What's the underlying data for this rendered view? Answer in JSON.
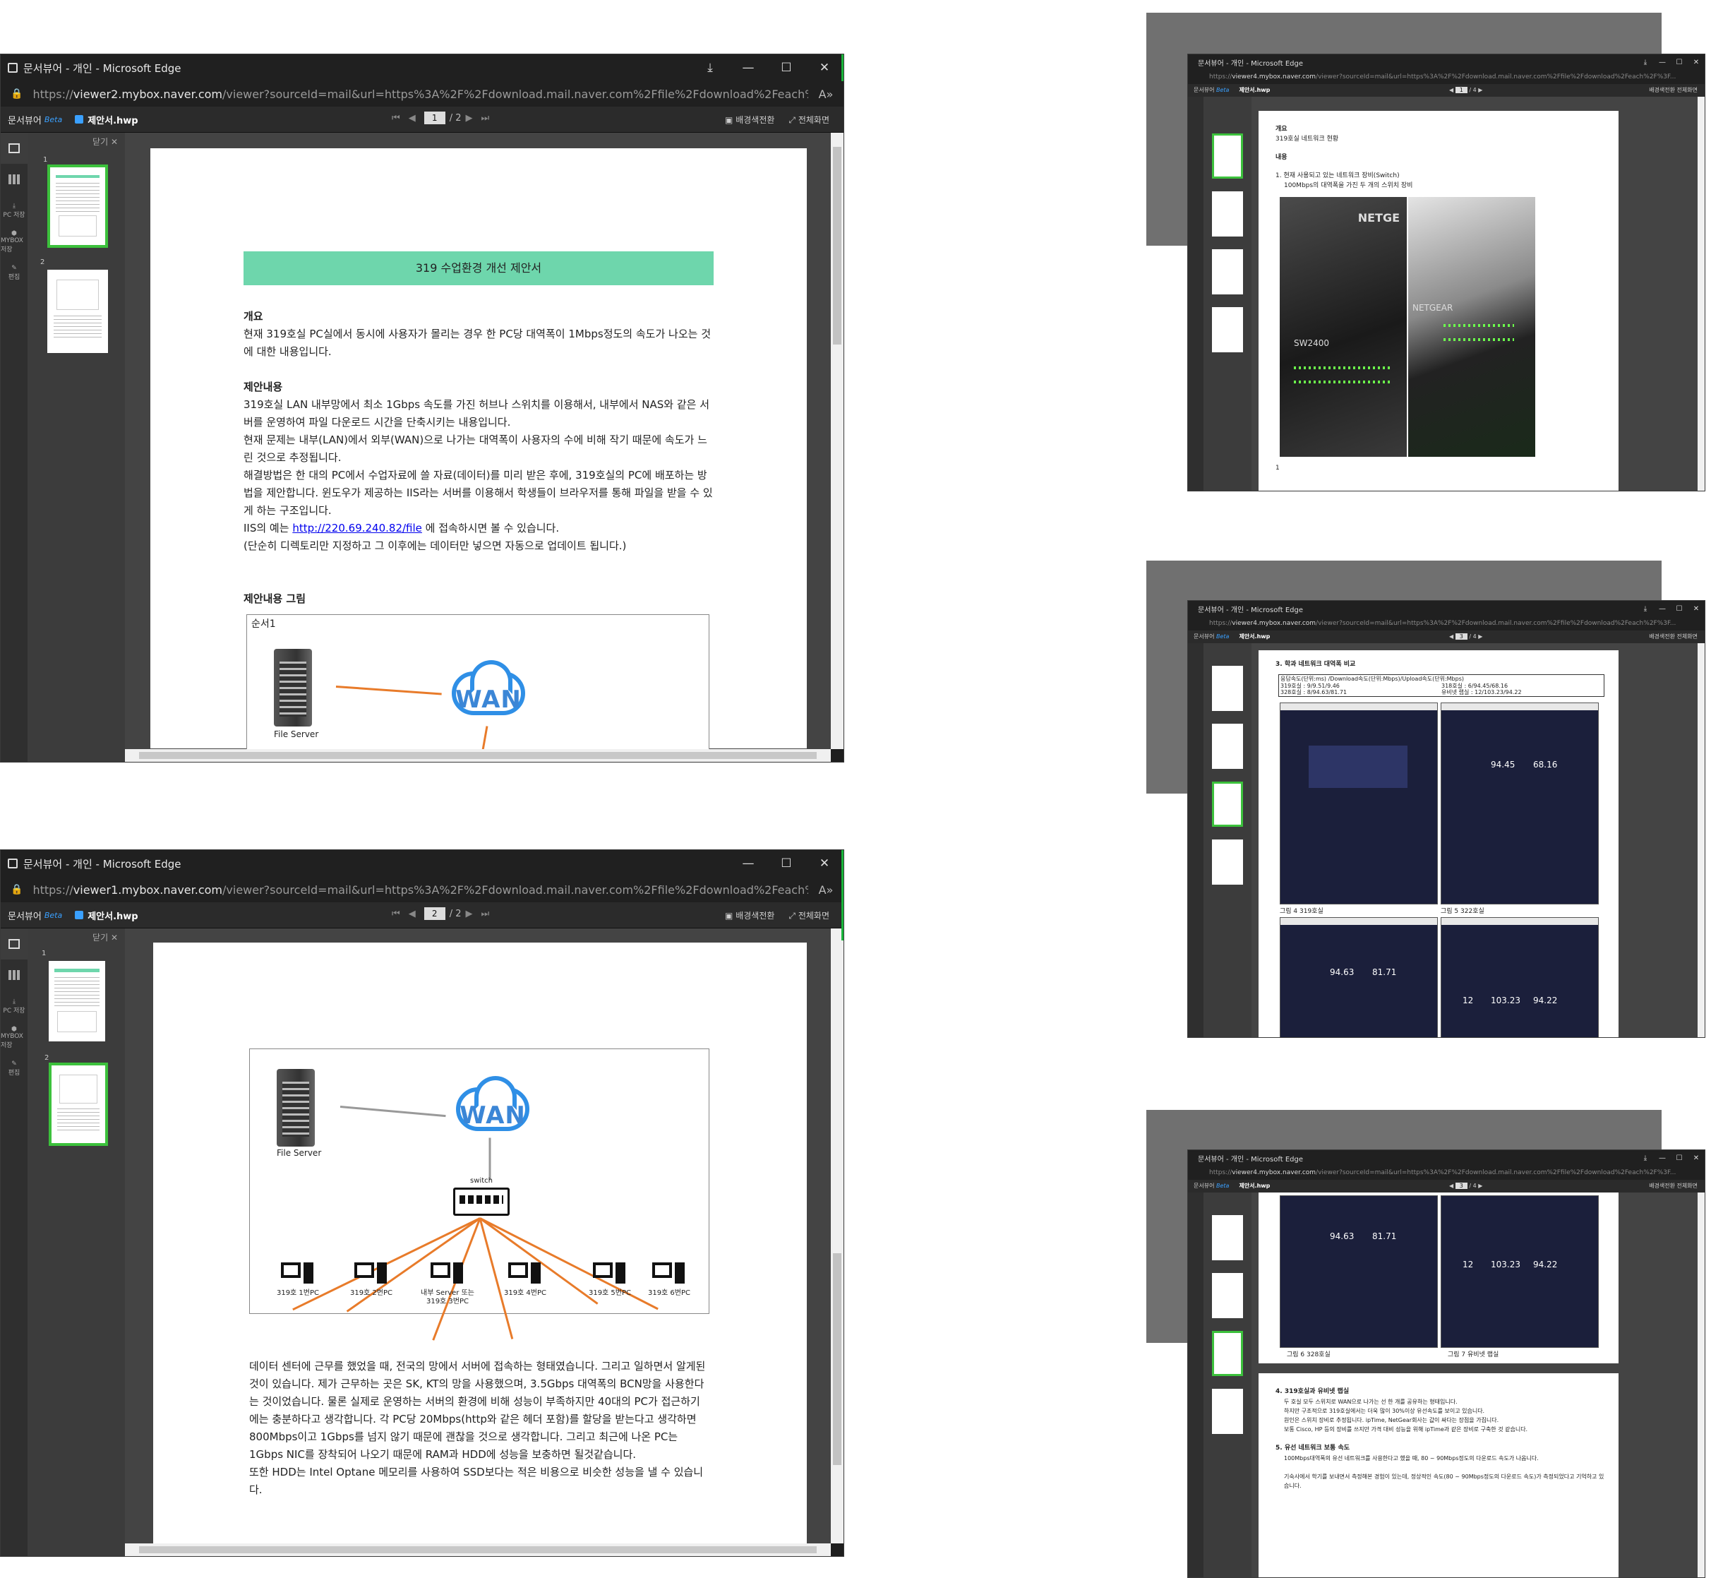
{
  "window_title": "문서뷰어 - 개인 - Microsoft Edge",
  "url_tl": {
    "pre": "https://",
    "host": "viewer2.mybox.naver.com",
    "rest": "/viewer?sourceId=mail&url=https%3A%2F%2Fdownload.mail.naver.com%2Ffile%2Fdownload%2Feach%2F%3Fattach..."
  },
  "url_bl": {
    "pre": "https://",
    "host": "viewer1.mybox.naver.com",
    "rest": "/viewer?sourceId=mail&url=https%3A%2F%2Fdownload.mail.naver.com%2Ffile%2Fdownload%2Feach%2F%3Fattach..."
  },
  "url_r": {
    "pre": "https://",
    "host": "viewer4.mybox.naver.com",
    "rest": "/viewer?sourceId=mail&url=https%3A%2F%2Fdownload.mail.naver.com%2Ffile%2Fdownload%2Feach%2F%3F..."
  },
  "toolbar": {
    "brand": "문서뷰어",
    "beta": "Beta",
    "filename": "제안서.hwp",
    "page_tl": "1",
    "page_bl": "2",
    "total_2": "/ 2",
    "total_4": "/ 4",
    "bg_toggle": "배경색전환",
    "fullscreen": "전체화면",
    "page_r1": "1",
    "page_r2": "3",
    "page_r3": "3"
  },
  "sidebar": {
    "pc_save": "PC 저장",
    "mybox_save": "MYBOX 저장",
    "edit": "편집"
  },
  "thumbpane": {
    "close": "닫기",
    "p1": "1",
    "p2": "2",
    "p3": "3",
    "p4": "4"
  },
  "page1": {
    "title": "319 수업환경 개선 제안서",
    "overview_h": "개요",
    "overview": "현재 319호실 PC실에서 동시에 사용자가 몰리는 경우 한 PC당 대역폭이 1Mbps정도의 속도가 나오는 것에 대한 내용입니다.",
    "proposal_h": "제안내용",
    "p1": "319호실 LAN 내부망에서 최소 1Gbps 속도를 가진 허브나 스위치를 이용해서, 내부에서 NAS와 같은 서버를 운영하여 파일 다운로드 시간을 단축시키는 내용입니다.",
    "p2": "현재 문제는 내부(LAN)에서 외부(WAN)으로 나가는 대역폭이 사용자의 수에 비해 작기 때문에 속도가 느린 것으로 추정됩니다.",
    "p3": "해결방법은 한 대의 PC에서 수업자료에 쓸 자료(데이터)를 미리 받은 후에, 319호실의 PC에 배포하는 방법을 제안합니다. 윈도우가 제공하는 IIS라는 서버를 이용해서 학생들이 브라우저를 통해 파일을 받을 수 있게 하는 구조입니다.",
    "p4_pre": "IIS의 예는 ",
    "p4_link": "http://220.69.240.82/file",
    "p4_post": " 에 접속하시면 볼 수 있습니다.",
    "p5": "(단순히 디렉토리만 지정하고 그 이후에는 데이터만 넣으면 자동으로 업데이트 됩니다.)",
    "figure_h": "제안내용 그림",
    "figure_step": "순서1",
    "file_server": "File Server",
    "wan": "WAN"
  },
  "page2": {
    "file_server": "File Server",
    "wan": "WAN",
    "switch": "switch",
    "pcs": [
      "319호 1번PC",
      "319호 2번PC",
      "내부 Server 또는 319호 3번PC",
      "319호 4번PC",
      "319호 5번PC",
      "319호 6번PC"
    ],
    "body1": "데이터 센터에 근무를 했었을 때, 전국의 망에서 서버에 접속하는 형태였습니다. 그리고 일하면서 알게된 것이 있습니다. 제가 근무하는 곳은 SK, KT의 망을 사용했으며, 3.5Gbps 대역폭의 BCN망을 사용한다는 것이었습니다. 물론 실제로 운영하는 서버의 환경에 비해 성능이 부족하지만 40대의 PC가 접근하기에는 충분하다고 생각합니다. 각 PC당 20Mbps(http와 같은 헤더 포함)를 할당을 받는다고 생각하면 800Mbps이고 1Gbps를 넘지 않기 때문에 괜찮을 것으로 생각합니다. 그리고 최근에 나온 PC는 1Gbps NIC를 장착되어 나오기 때문에 RAM과 HDD에 성능을 보충하면 될것같습니다.",
    "body2": "또한 HDD는 Intel Optane 메모리를 사용하여 SSD보다는 적은 비용으로 비슷한 성능을 낼 수 있습니다."
  },
  "r1": {
    "h1": "개요",
    "l1": "319호실 네트워크 현황",
    "h2": "내용",
    "l2": "1. 현재 사용되고 있는 네트워크 장비(Switch)",
    "l3": "100Mbps의 대역폭을 가진 두 개의 스위치 장비",
    "brand1": "NETGE",
    "brand2": "NETGEAR",
    "model": "SW2400",
    "pnum": "1"
  },
  "r2": {
    "h": "3. 학과 네트워크 대역폭 비교",
    "thead": "응답속도(단위:ms) /Download속도(단위:Mbps)/Upload속도(단위:Mbps)",
    "c1": "319호실 : 9/9.51/9.46",
    "c2": "318호실 : 6/94.45/68.16",
    "c3": "328호실 : 8/94.63/81.71",
    "c4": "유비넷 랩실 : 12/103.23/94.22",
    "cap4": "그림 4 319호실",
    "cap5": "그림 5 322호실",
    "n1": "94.45",
    "n2": "68.16",
    "n3": "94.63",
    "n4": "81.71",
    "n5": "103.23",
    "n6": "94.22",
    "n7": "12"
  },
  "r3": {
    "cap6": "그림 6 328호실",
    "cap7": "그림 7 유비넷 랩실",
    "n1": "94.63",
    "n2": "81.71",
    "n3": "103.23",
    "n4": "94.22",
    "n5": "12",
    "h4": "4. 319호실과 유비넷 랩실",
    "t4a": "두 호실 모두 스위치로 WAN으로 나가는 선 한 개를 공유하는 형태입니다.",
    "t4b": "하지만 구조적으로 319호실에서는 더욱 많이 30%이상 유선속도를 보이고 있습니다.",
    "t4c": "원인은 스위치 장비로 추정됩니다. ipTime, NetGear회사는 값이 싸다는 장점을 가집니다.",
    "t4d": "보통 Cisco, HP 등의 장비를 쓰지만 가격 대비 성능을 위해 ipTime과 같은 장비로 구축한 것 같습니다.",
    "h5": "5. 유선 네트워크 보통 속도",
    "t5a": "100Mbps대역폭의 유선 네트워크를 사용한다고 했을 때, 80 ~ 90Mbps정도의 다운로드 속도가 나옵니다.",
    "t5b": "기숙사에서 학기를 보내면서 측정해본 경험이 있는데, 정상적인 속도(80 ~ 90Mbps정도의 다운로드 속도)가 측정되었다고 기억하고 있습니다."
  }
}
